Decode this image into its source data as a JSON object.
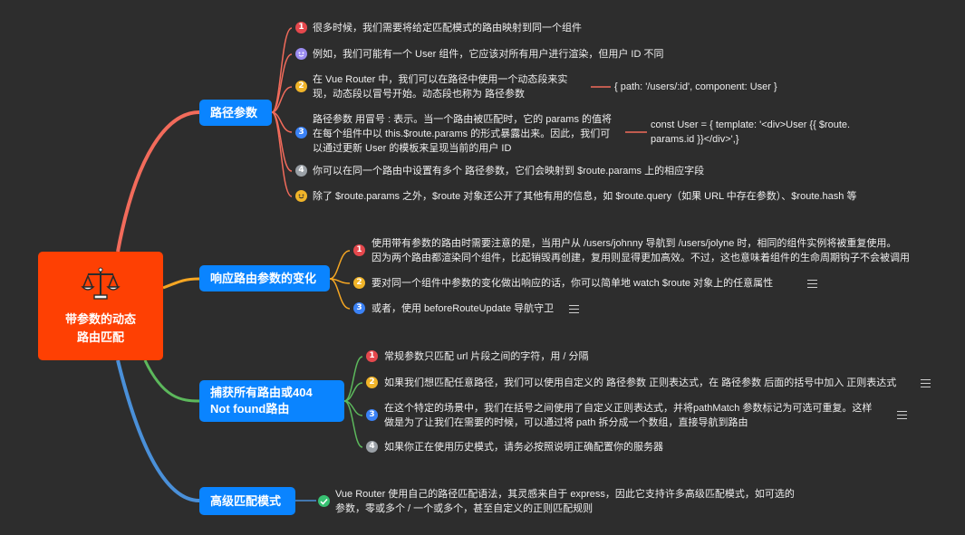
{
  "root": {
    "title_line1": "带参数的动态",
    "title_line2": "路由匹配"
  },
  "topics": {
    "path_params": "路径参数",
    "react_params": "响应路由参数的变化",
    "catch_all_line1": "捕获所有路由或404",
    "catch_all_line2": "Not found路由",
    "advanced": "高级匹配模式"
  },
  "path_params": {
    "item1": "很多时候，我们需要将给定匹配模式的路由映射到同一个组件",
    "item2": "例如，我们可能有一个 User 组件，它应该对所有用户进行渲染，但用户 ID 不同",
    "item3_line1": "在 Vue Router 中，我们可以在路径中使用一个动态段来实",
    "item3_line2": "现，动态段以冒号开始。动态段也称为 路径参数",
    "item3_code": "{ path: '/users/:id', component: User }",
    "item4_line1": "路径参数 用冒号 : 表示。当一个路由被匹配时，它的 params 的值将",
    "item4_line2": "在每个组件中以 this.$route.params 的形式暴露出来。因此，我们可",
    "item4_line3": "以通过更新 User 的模板来呈现当前的用户 ID",
    "item4_code_line1": "const User = {  template: '<div>User {{ $route.",
    "item4_code_line2": "params.id }}</div>',}",
    "item5": "你可以在同一个路由中设置有多个 路径参数，它们会映射到 $route.params 上的相应字段",
    "item6": "除了 $route.params 之外，$route 对象还公开了其他有用的信息，如 $route.query（如果 URL 中存在参数）、$route.hash 等"
  },
  "react_params": {
    "item1_line1": "使用带有参数的路由时需要注意的是，当用户从 /users/johnny 导航到 /users/jolyne 时，相同的组件实例将被重复使用。",
    "item1_line2": "因为两个路由都渲染同个组件，比起销毁再创建，复用则显得更加高效。不过，这也意味着组件的生命周期钩子不会被调用",
    "item2": "要对同一个组件中参数的变化做出响应的话，你可以简单地 watch $route 对象上的任意属性",
    "item3": "或者，使用 beforeRouteUpdate 导航守卫"
  },
  "catch_all": {
    "item1": "常规参数只匹配 url 片段之间的字符，用 / 分隔",
    "item2": "如果我们想匹配任意路径，我们可以使用自定义的 路径参数 正则表达式，在 路径参数 后面的括号中加入 正则表达式",
    "item3_line1": "在这个特定的场景中，我们在括号之间使用了自定义正则表达式，并将pathMatch 参数标记为可选可重复。这样",
    "item3_line2": "做是为了让我们在需要的时候，可以通过将 path 拆分成一个数组，直接导航到路由",
    "item4": "如果你正在使用历史模式，请务必按照说明正确配置你的服务器"
  },
  "advanced": {
    "item1_line1": "Vue Router 使用自己的路径匹配语法，其灵感来自于 express，因此它支持许多高级匹配模式，如可选的",
    "item1_line2": "参数，零或多个 / 一个或多个，甚至自定义的正则匹配规则"
  },
  "badges": {
    "one": "1",
    "two": "2",
    "three": "3",
    "four": "4"
  },
  "colors": {
    "background": "#2d2d2d",
    "root": "#fe4003",
    "topic": "#0a84ff",
    "branch_path": "#f26b5b",
    "branch_react": "#f5a623",
    "branch_catch": "#5cb85c",
    "branch_advanced": "#4a90d9"
  },
  "icons": {
    "root": "scales-icon",
    "note": "note-lines-icon",
    "check": "check-icon",
    "smile": "smile-icon",
    "emoji": "emoji-icon"
  }
}
